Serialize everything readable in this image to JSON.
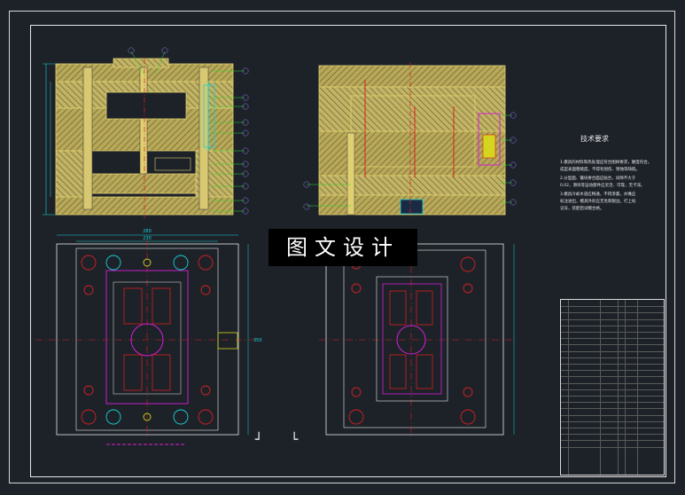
{
  "watermark": {
    "text": "图文设计"
  },
  "technical_requirements": {
    "title": "技术要求",
    "lines": [
      "1.模具的材料和热处理应符合图样要求，硬度符合。",
      "成型表面粗糙度，不得有划伤、锈蚀等缺陷。",
      "2.分型面、镶块拼合面应贴合，间隙不大于",
      "0.02，滑块等运动部件应灵活、可靠，无卡滞。",
      "3.模具冷却水道应畅通，不得渗漏，水嘴应",
      "标注进出，模具外形应无毛刺锐边，打上标",
      "记号，装配后试模合格。"
    ]
  },
  "dimensions": {
    "width_top": "280",
    "width_inner": "230",
    "height_side": "350"
  },
  "colors": {
    "background": "#1d2229",
    "plate_fill": "#b7a85a",
    "hatch": "#8a7c35",
    "cyan": "#19d3d3",
    "magenta": "#d51fd5",
    "red": "#d52020",
    "yellow": "#d5d51f",
    "green": "#2fd52f",
    "white": "#e8e8e8"
  }
}
